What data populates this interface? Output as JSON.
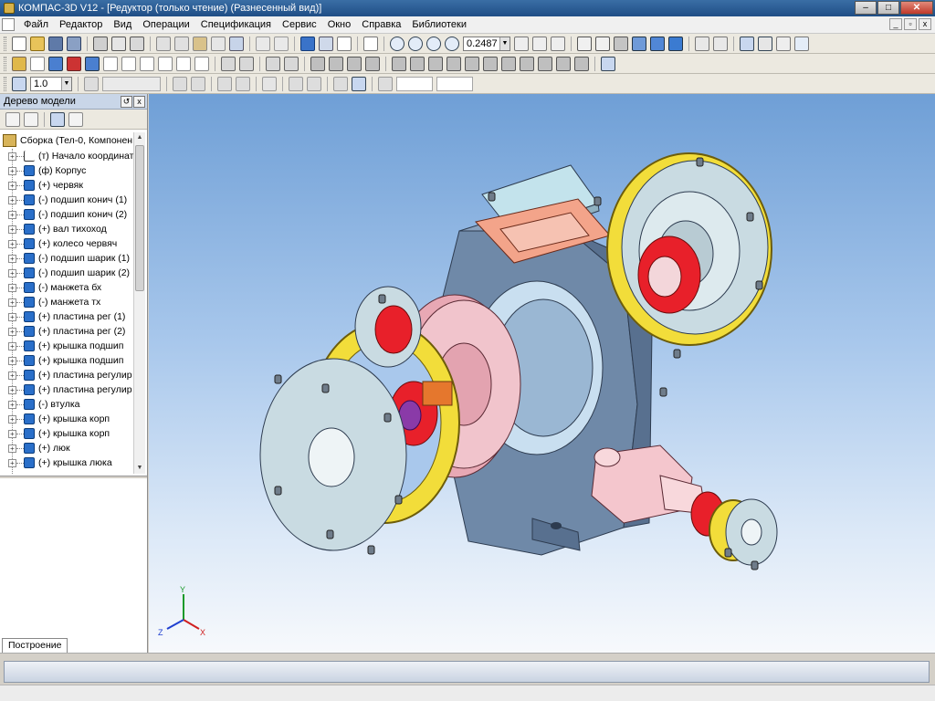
{
  "window": {
    "title": "КОМПАС-3D V12 - [Редуктор (только чтение) (Разнесенный вид)]"
  },
  "menu": [
    "Файл",
    "Редактор",
    "Вид",
    "Операции",
    "Спецификация",
    "Сервис",
    "Окно",
    "Справка",
    "Библиотеки"
  ],
  "toolbar": {
    "zoom_value": "0.2487",
    "step_value": "1.0"
  },
  "panel": {
    "title": "Дерево модели",
    "tab_label": "Построение",
    "root": "Сборка (Тел-0, Компонен",
    "items": [
      "(т) Начало координат",
      "(ф) Корпус",
      "(+) червяк",
      "(-) подшип конич (1)",
      "(-) подшип конич (2)",
      "(+) вал тихоход",
      "(+) колесо червяч",
      "(-) подшип шарик (1)",
      "(-) подшип шарик (2)",
      "(-) манжета бх",
      "(-) манжета тх",
      "(+) пластина рег (1)",
      "(+) пластина рег (2)",
      "(+) крышка подшип",
      "(+) крышка подшип",
      "(+) пластина регулир",
      "(+) пластина регулир",
      "(-) втулка",
      "(+) крышка корп",
      "(+) крышка корп",
      "(+) люк",
      "(+) крышка люка"
    ]
  },
  "axes": {
    "x": "X",
    "y": "Y",
    "z": "Z"
  },
  "colors": {
    "body": "#6d88a8",
    "wheel": "#e8a8b4",
    "gasket": "#f2dd3a",
    "bearing": "#e8202a",
    "cover": "#c9dbe2"
  }
}
